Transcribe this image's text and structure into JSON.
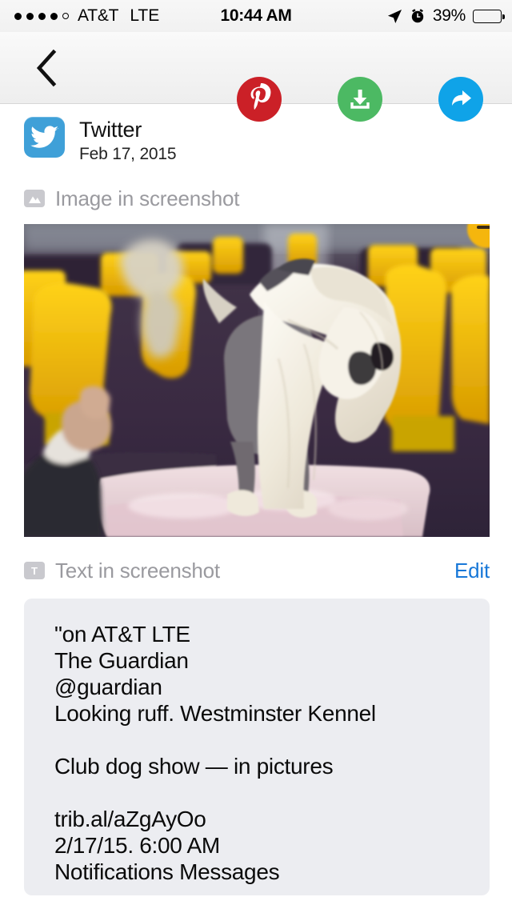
{
  "status_bar": {
    "signal_dots_filled": 4,
    "signal_dots_total": 5,
    "carrier": "AT&T",
    "network": "LTE",
    "time": "10:44 AM",
    "battery_percent": "39%",
    "battery_level": 39,
    "icons": [
      "location-arrow-icon",
      "alarm-clock-icon",
      "battery-icon"
    ]
  },
  "toolbar": {
    "back_icon": "chevron-left-icon",
    "actions": [
      {
        "name": "pinterest-button",
        "icon": "pinterest-icon",
        "color": "#cb2027"
      },
      {
        "name": "download-button",
        "icon": "download-icon",
        "color": "#4cb963"
      },
      {
        "name": "share-button",
        "icon": "share-arrow-icon",
        "color": "#0fa3e8"
      }
    ]
  },
  "source": {
    "app_icon": "twitter-icon",
    "app_icon_color": "#3fa0d8",
    "app_name": "Twitter",
    "date": "Feb 17, 2015"
  },
  "image_section": {
    "badge_icon": "image-badge-icon",
    "label": "Image in screenshot"
  },
  "text_section": {
    "badge_icon": "text-badge-icon",
    "badge_letter": "T",
    "label": "Text in screenshot",
    "edit_label": "Edit",
    "edit_color": "#1878d8"
  },
  "ocr_text": {
    "lines": [
      "\"on AT&T LTE",
      "The Guardian",
      "@guardian",
      "Looking ruff. Westminster Kennel",
      "",
      "Club dog show — in pictures",
      "",
      "trib.al/aZgAyOo",
      "2/17/15. 6:00 AM",
      "Notifications Messages"
    ]
  },
  "photo": {
    "description": "Chinese Crested dog standing on a pink grooming table at the Westminster Kennel Club dog show, yellow chairs and purple backdrop behind, handler's hand at left",
    "palette": {
      "backdrop": "#3a2b45",
      "chair_yellow": "#f2c200",
      "table_pink": "#e7cdd2",
      "dog_hair": "#f3efe4",
      "dog_body": "#6d6a6e"
    }
  }
}
